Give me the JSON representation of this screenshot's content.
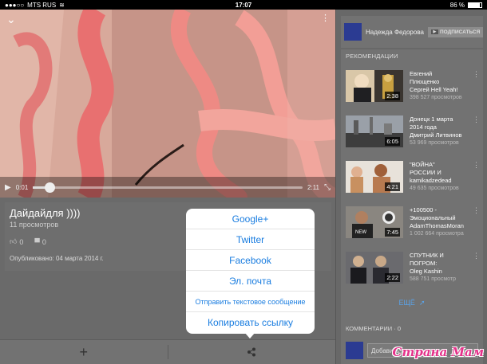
{
  "status_bar": {
    "carrier": "MTS RUS",
    "time": "17:07",
    "battery": "86 %",
    "battery_level": 0.86
  },
  "player": {
    "current_time": "0:01",
    "duration": "2:11",
    "progress": 0.06
  },
  "video_info": {
    "title": "Дайдайдля ))))",
    "views": "11 просмотров",
    "likes": "0",
    "dislikes": "0",
    "published": "Опубликовано: 04 марта 2014 г."
  },
  "share_sheet": {
    "items": [
      "Google+",
      "Twitter",
      "Facebook",
      "Эл. почта",
      "Отправить текстовое сообщение",
      "Копировать ссылку"
    ]
  },
  "channel": {
    "name": "Надежда Федорова",
    "subscribe_label": "ПОДПИСАТЬСЯ"
  },
  "recommendations": {
    "header": "РЕКОМЕНДАЦИИ",
    "items": [
      {
        "title": [
          "Евгений",
          "Плющенко",
          "Сергей Hell Yeah!"
        ],
        "views": "398 527 просмотров",
        "duration": "2:38"
      },
      {
        "title": [
          "Донецк 1 марта",
          "2014 года",
          "Дмитрий Литвинов"
        ],
        "views": "53 969 просмотров",
        "duration": "6:05"
      },
      {
        "title": [
          "\"ВОЙНА\"",
          "РОССИИ И",
          "kamikadzedead"
        ],
        "views": "49 635 просмотров",
        "duration": "4:21"
      },
      {
        "title": [
          "+100500 -",
          "Эмоциональный",
          "AdamThomasMoran"
        ],
        "views": "1 002 664 просмотра",
        "duration": "7:45"
      },
      {
        "title": [
          "СПУТНИК И",
          "ПОГРОМ:",
          "Oleg Kashin"
        ],
        "views": "588 751 просмотр",
        "duration": "2:22"
      }
    ],
    "more_label": "ЕЩЁ"
  },
  "comments": {
    "header": "КОММЕНТАРИИ · 0",
    "placeholder": "Добавить комм..."
  },
  "watermark": "Страна Мам"
}
